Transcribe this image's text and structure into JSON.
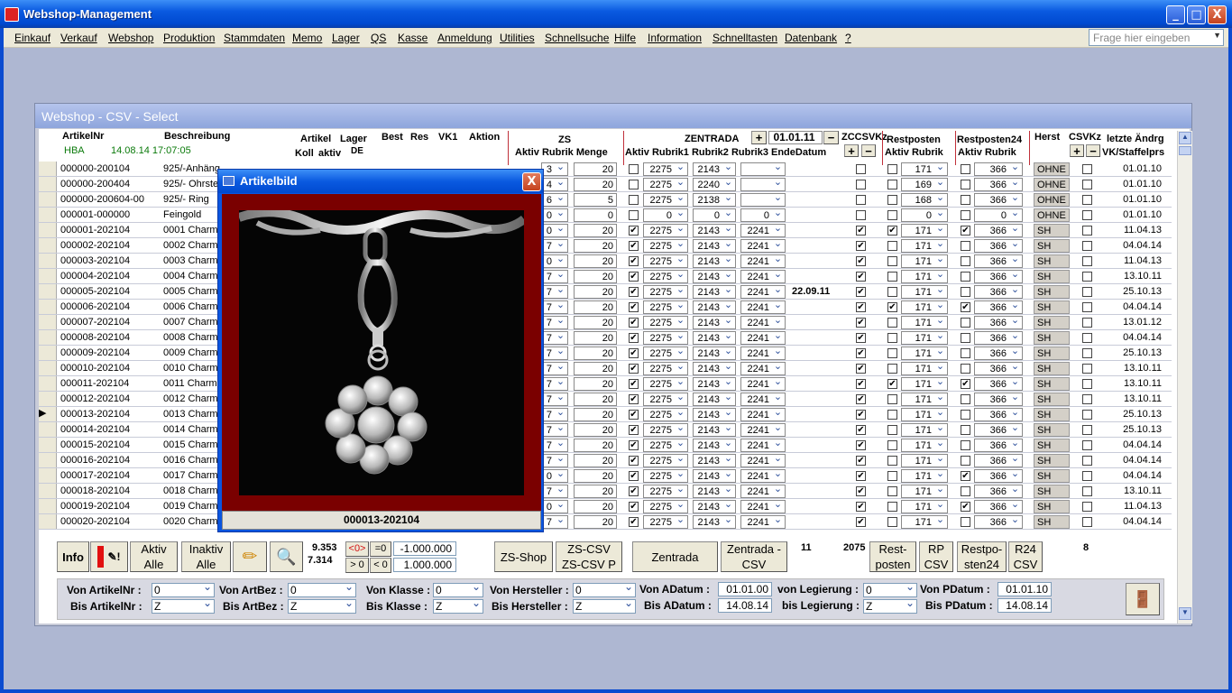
{
  "app": {
    "title": "Webshop-Management",
    "minimize": "_",
    "maximize": "□",
    "close": "X",
    "help_placeholder": "Frage hier eingeben",
    "menus": [
      "Einkauf",
      "Verkauf",
      "Webshop",
      "Produktion",
      "Stammdaten",
      "Memo",
      "Lager",
      "QS",
      "Kasse",
      "Anmeldung",
      "Utilities",
      "Schnellsuche",
      "Hilfe",
      "Information",
      "Schnelltasten",
      "Datenbank",
      "?"
    ]
  },
  "form": {
    "title": "Webshop - CSV - Select",
    "header": {
      "artikelnr": "ArtikelNr",
      "beschreibung": "Beschreibung",
      "hba": "HBA",
      "timestamp": "14.08.14 17:07:05",
      "artikel": "Artikel",
      "koll": "Koll",
      "aktiv": "aktiv",
      "lager": "Lager",
      "de": "DE",
      "best": "Best",
      "res": "Res",
      "vk1": "VK1",
      "aktion": "Aktion",
      "zs": "ZS",
      "zs_sub": "Aktiv Rubrik Menge",
      "zentrada": "ZENTRADA",
      "plus": "+",
      "minus": "−",
      "zentrada_date": "01.01.11",
      "zentrada_sub": "Aktiv Rubrik1 Rubrik2 Rubrik3 EndeDatum",
      "zc_csvkz": "ZCCSVKz",
      "restposten": "Restposten",
      "restposten_sub": "Aktiv Rubrik",
      "restposten24": "Restposten24",
      "restposten24_sub": "Aktiv Rubrik",
      "herst": "Herst",
      "csvkz": "CSVKz",
      "letzte_aendrg": "letzte Ändrg",
      "vk_staffel": "VK/Staffelprs"
    },
    "rows": [
      {
        "nr": "000000-200104",
        "bez": "925/-Anhäng",
        "zs_r": "3",
        "zs_m": "20",
        "z_a": false,
        "r1": "2275",
        "r2": "2143",
        "r3": "",
        "ende": "",
        "zc": false,
        "rp_a": false,
        "rp_r": "171",
        "r24_a": false,
        "r24_r": "366",
        "herst": "OHNE",
        "csv": false,
        "date": "01.01.10"
      },
      {
        "nr": "000000-200404",
        "bez": "925/- Ohrste",
        "zs_r": "4",
        "zs_m": "20",
        "z_a": false,
        "r1": "2275",
        "r2": "2240",
        "r3": "",
        "ende": "",
        "zc": false,
        "rp_a": false,
        "rp_r": "169",
        "r24_a": false,
        "r24_r": "366",
        "herst": "OHNE",
        "csv": false,
        "date": "01.01.10"
      },
      {
        "nr": "000000-200604-00",
        "bez": "925/- Ring",
        "zs_r": "6",
        "zs_m": "5",
        "z_a": false,
        "r1": "2275",
        "r2": "2138",
        "r3": "",
        "ende": "",
        "zc": false,
        "rp_a": false,
        "rp_r": "168",
        "r24_a": false,
        "r24_r": "366",
        "herst": "OHNE",
        "csv": false,
        "date": "01.01.10"
      },
      {
        "nr": "000001-000000",
        "bez": "Feingold",
        "zs_r": "0",
        "zs_m": "0",
        "z_a": false,
        "r1": "0",
        "r2": "0",
        "r3": "0",
        "ende": "",
        "zc": false,
        "rp_a": false,
        "rp_r": "0",
        "r24_a": false,
        "r24_r": "0",
        "herst": "OHNE",
        "csv": false,
        "date": "01.01.10"
      },
      {
        "nr": "000001-202104",
        "bez": "0001 Charm",
        "zs_r": "0",
        "zs_m": "20",
        "z_a": true,
        "r1": "2275",
        "r2": "2143",
        "r3": "2241",
        "ende": "",
        "zc": true,
        "rp_a": true,
        "rp_r": "171",
        "r24_a": true,
        "r24_r": "366",
        "herst": "SH",
        "csv": false,
        "date": "11.04.13"
      },
      {
        "nr": "000002-202104",
        "bez": "0002 Charm",
        "zs_r": "7",
        "zs_m": "20",
        "z_a": true,
        "r1": "2275",
        "r2": "2143",
        "r3": "2241",
        "ende": "",
        "zc": true,
        "rp_a": false,
        "rp_r": "171",
        "r24_a": false,
        "r24_r": "366",
        "herst": "SH",
        "csv": false,
        "date": "04.04.14"
      },
      {
        "nr": "000003-202104",
        "bez": "0003 Charm",
        "zs_r": "0",
        "zs_m": "20",
        "z_a": true,
        "r1": "2275",
        "r2": "2143",
        "r3": "2241",
        "ende": "",
        "zc": true,
        "rp_a": false,
        "rp_r": "171",
        "r24_a": false,
        "r24_r": "366",
        "herst": "SH",
        "csv": false,
        "date": "11.04.13"
      },
      {
        "nr": "000004-202104",
        "bez": "0004 Charm",
        "zs_r": "7",
        "zs_m": "20",
        "z_a": true,
        "r1": "2275",
        "r2": "2143",
        "r3": "2241",
        "ende": "",
        "zc": true,
        "rp_a": false,
        "rp_r": "171",
        "r24_a": false,
        "r24_r": "366",
        "herst": "SH",
        "csv": false,
        "date": "13.10.11"
      },
      {
        "nr": "000005-202104",
        "bez": "0005 Charm",
        "zs_r": "7",
        "zs_m": "20",
        "z_a": true,
        "r1": "2275",
        "r2": "2143",
        "r3": "2241",
        "ende": "22.09.11",
        "zc": true,
        "rp_a": false,
        "rp_r": "171",
        "r24_a": false,
        "r24_r": "366",
        "herst": "SH",
        "csv": false,
        "date": "25.10.13"
      },
      {
        "nr": "000006-202104",
        "bez": "0006 Charm",
        "zs_r": "7",
        "zs_m": "20",
        "z_a": true,
        "r1": "2275",
        "r2": "2143",
        "r3": "2241",
        "ende": "",
        "zc": true,
        "rp_a": true,
        "rp_r": "171",
        "r24_a": true,
        "r24_r": "366",
        "herst": "SH",
        "csv": false,
        "date": "04.04.14"
      },
      {
        "nr": "000007-202104",
        "bez": "0007 Charm",
        "zs_r": "7",
        "zs_m": "20",
        "z_a": true,
        "r1": "2275",
        "r2": "2143",
        "r3": "2241",
        "ende": "",
        "zc": true,
        "rp_a": false,
        "rp_r": "171",
        "r24_a": false,
        "r24_r": "366",
        "herst": "SH",
        "csv": false,
        "date": "13.01.12"
      },
      {
        "nr": "000008-202104",
        "bez": "0008 Charm",
        "zs_r": "7",
        "zs_m": "20",
        "z_a": true,
        "r1": "2275",
        "r2": "2143",
        "r3": "2241",
        "ende": "",
        "zc": true,
        "rp_a": false,
        "rp_r": "171",
        "r24_a": false,
        "r24_r": "366",
        "herst": "SH",
        "csv": false,
        "date": "04.04.14"
      },
      {
        "nr": "000009-202104",
        "bez": "0009 Charm",
        "zs_r": "7",
        "zs_m": "20",
        "z_a": true,
        "r1": "2275",
        "r2": "2143",
        "r3": "2241",
        "ende": "",
        "zc": true,
        "rp_a": false,
        "rp_r": "171",
        "r24_a": false,
        "r24_r": "366",
        "herst": "SH",
        "csv": false,
        "date": "25.10.13"
      },
      {
        "nr": "000010-202104",
        "bez": "0010 Charm",
        "zs_r": "7",
        "zs_m": "20",
        "z_a": true,
        "r1": "2275",
        "r2": "2143",
        "r3": "2241",
        "ende": "",
        "zc": true,
        "rp_a": false,
        "rp_r": "171",
        "r24_a": false,
        "r24_r": "366",
        "herst": "SH",
        "csv": false,
        "date": "13.10.11"
      },
      {
        "nr": "000011-202104",
        "bez": "0011 Charm",
        "zs_r": "7",
        "zs_m": "20",
        "z_a": true,
        "r1": "2275",
        "r2": "2143",
        "r3": "2241",
        "ende": "",
        "zc": true,
        "rp_a": true,
        "rp_r": "171",
        "r24_a": true,
        "r24_r": "366",
        "herst": "SH",
        "csv": false,
        "date": "13.10.11"
      },
      {
        "nr": "000012-202104",
        "bez": "0012 Charm",
        "zs_r": "7",
        "zs_m": "20",
        "z_a": true,
        "r1": "2275",
        "r2": "2143",
        "r3": "2241",
        "ende": "",
        "zc": true,
        "rp_a": false,
        "rp_r": "171",
        "r24_a": false,
        "r24_r": "366",
        "herst": "SH",
        "csv": false,
        "date": "13.10.11"
      },
      {
        "nr": "000013-202104",
        "bez": "0013 Charm",
        "zs_r": "7",
        "zs_m": "20",
        "z_a": true,
        "r1": "2275",
        "r2": "2143",
        "r3": "2241",
        "ende": "",
        "zc": true,
        "rp_a": false,
        "rp_r": "171",
        "r24_a": false,
        "r24_r": "366",
        "herst": "SH",
        "csv": false,
        "date": "25.10.13",
        "current": true
      },
      {
        "nr": "000014-202104",
        "bez": "0014 Charm",
        "zs_r": "7",
        "zs_m": "20",
        "z_a": true,
        "r1": "2275",
        "r2": "2143",
        "r3": "2241",
        "ende": "",
        "zc": true,
        "rp_a": false,
        "rp_r": "171",
        "r24_a": false,
        "r24_r": "366",
        "herst": "SH",
        "csv": false,
        "date": "25.10.13"
      },
      {
        "nr": "000015-202104",
        "bez": "0015 Charm",
        "zs_r": "7",
        "zs_m": "20",
        "z_a": true,
        "r1": "2275",
        "r2": "2143",
        "r3": "2241",
        "ende": "",
        "zc": true,
        "rp_a": false,
        "rp_r": "171",
        "r24_a": false,
        "r24_r": "366",
        "herst": "SH",
        "csv": false,
        "date": "04.04.14"
      },
      {
        "nr": "000016-202104",
        "bez": "0016 Charm",
        "zs_r": "7",
        "zs_m": "20",
        "z_a": true,
        "r1": "2275",
        "r2": "2143",
        "r3": "2241",
        "ende": "",
        "zc": true,
        "rp_a": false,
        "rp_r": "171",
        "r24_a": false,
        "r24_r": "366",
        "herst": "SH",
        "csv": false,
        "date": "04.04.14"
      },
      {
        "nr": "000017-202104",
        "bez": "0017 Charm",
        "zs_r": "0",
        "zs_m": "20",
        "z_a": true,
        "r1": "2275",
        "r2": "2143",
        "r3": "2241",
        "ende": "",
        "zc": true,
        "rp_a": false,
        "rp_r": "171",
        "r24_a": true,
        "r24_r": "366",
        "herst": "SH",
        "csv": false,
        "date": "04.04.14"
      },
      {
        "nr": "000018-202104",
        "bez": "0018 Charm",
        "zs_r": "7",
        "zs_m": "20",
        "z_a": true,
        "r1": "2275",
        "r2": "2143",
        "r3": "2241",
        "ende": "",
        "zc": true,
        "rp_a": false,
        "rp_r": "171",
        "r24_a": false,
        "r24_r": "366",
        "herst": "SH",
        "csv": false,
        "date": "13.10.11"
      },
      {
        "nr": "000019-202104",
        "bez": "0019 Charm",
        "zs_r": "0",
        "zs_m": "20",
        "z_a": true,
        "r1": "2275",
        "r2": "2143",
        "r3": "2241",
        "ende": "",
        "zc": true,
        "rp_a": false,
        "rp_r": "171",
        "r24_a": true,
        "r24_r": "366",
        "herst": "SH",
        "csv": false,
        "date": "11.04.13"
      },
      {
        "nr": "000020-202104",
        "bez": "0020 Charm",
        "zs_r": "7",
        "zs_m": "20",
        "z_a": true,
        "r1": "2275",
        "r2": "2143",
        "r3": "2241",
        "ende": "",
        "zc": true,
        "rp_a": false,
        "rp_r": "171",
        "r24_a": false,
        "r24_r": "366",
        "herst": "SH",
        "csv": false,
        "date": "04.04.14"
      }
    ],
    "buttons": {
      "info": "Info",
      "aktiv_alle": "Aktiv\nAlle",
      "inaktiv_alle": "Inaktiv\nAlle",
      "count1": "9.353",
      "count2": "7.314",
      "neq": "<0>",
      "eq0": "=0",
      "gt0": "> 0",
      "lt0": "< 0",
      "range_from": "-1.000.000",
      "range_to": "1.000.000",
      "zs_shop": "ZS-Shop",
      "zs_csv": "ZS-CSV\nZS-CSV P",
      "zentrada": "Zentrada",
      "zentrada_csv": "Zentrada -\nCSV",
      "count_zentrada": "11",
      "count_zc": "2075",
      "restposten": "Rest-\nposten",
      "rp_csv": "RP\nCSV",
      "restposten24": "Restpo-\nsten24",
      "r24_csv": "R24\nCSV",
      "count_r24": "8"
    },
    "filters": {
      "von_artikelnr": "Von ArtikelNr :",
      "von_artikelnr_val": "0",
      "bis_artikelnr": "Bis ArtikelNr :",
      "bis_artikelnr_val": "Z",
      "von_artbez": "Von ArtBez :",
      "von_artbez_val": "0",
      "bis_artbez": "Bis ArtBez :",
      "bis_artbez_val": "Z",
      "von_klasse": "Von Klasse :",
      "von_klasse_val": "0",
      "bis_klasse": "Bis  Klasse :",
      "bis_klasse_val": "Z",
      "von_hersteller": "Von Hersteller :",
      "von_hersteller_val": "0",
      "bis_hersteller": "Bis  Hersteller :",
      "bis_hersteller_val": "Z",
      "von_adatum": "Von ADatum :",
      "von_adatum_val": "01.01.00",
      "bis_adatum": "Bis ADatum :",
      "bis_adatum_val": "14.08.14",
      "von_legierung": "von Legierung :",
      "von_legierung_val": "0",
      "bis_legierung": "bis Legierung :",
      "bis_legierung_val": "Z",
      "von_pdatum": "Von PDatum :",
      "von_pdatum_val": "01.01.10",
      "bis_pdatum": "Bis PDatum :",
      "bis_pdatum_val": "14.08.14"
    }
  },
  "popup": {
    "title": "Artikelbild",
    "close": "X",
    "caption": "000013-202104"
  }
}
